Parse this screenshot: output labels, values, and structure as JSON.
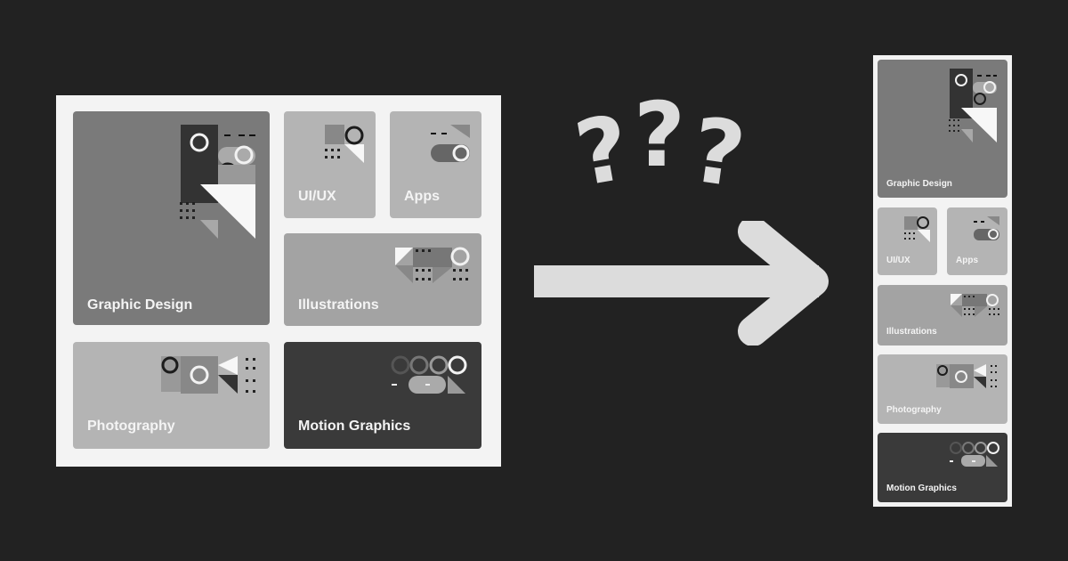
{
  "left_grid": {
    "cards": {
      "graphic_design": "Graphic Design",
      "uiux": "UI/UX",
      "apps": "Apps",
      "illustrations": "Illustrations",
      "photography": "Photography",
      "motion_graphics": "Motion Graphics"
    }
  },
  "middle": {
    "question_marks": "???",
    "arrow_icon": "right-arrow-icon"
  },
  "right_stack": {
    "cards": {
      "graphic_design": "Graphic Design",
      "uiux": "UI/UX",
      "apps": "Apps",
      "illustrations": "Illustrations",
      "photography": "Photography",
      "motion_graphics": "Motion Graphics"
    }
  },
  "colors": {
    "background": "#222222",
    "panel": "#f3f3f3",
    "card_dark_gray": "#7a7a7a",
    "card_light_gray": "#b4b4b4",
    "card_mid_gray": "#a3a3a3",
    "card_black": "#3a3a3a",
    "accent": "#dcdcdc"
  }
}
